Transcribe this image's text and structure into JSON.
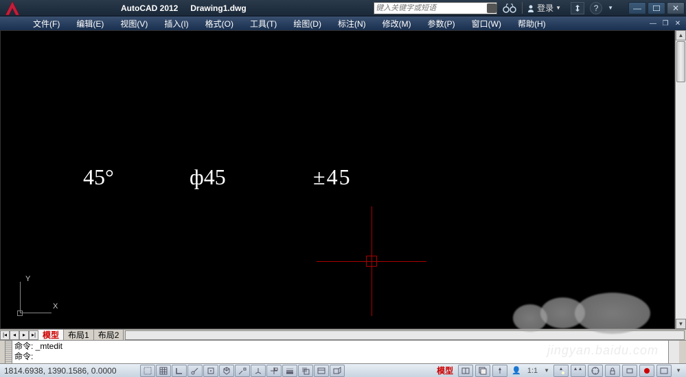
{
  "title": {
    "app": "AutoCAD 2012",
    "doc": "Drawing1.dwg"
  },
  "search": {
    "placeholder": "键入关键字或短语"
  },
  "login": {
    "label": "登录"
  },
  "menu": {
    "file": "文件(F)",
    "edit": "编辑(E)",
    "view": "视图(V)",
    "insert": "插入(I)",
    "format": "格式(O)",
    "tools": "工具(T)",
    "draw": "绘图(D)",
    "dim": "标注(N)",
    "modify": "修改(M)",
    "param": "参数(P)",
    "window": "窗口(W)",
    "help": "帮助(H)"
  },
  "canvas": {
    "text1": "45°",
    "text2": "ф45",
    "text3": "±45",
    "ucs_y": "Y",
    "ucs_x": "X"
  },
  "tabs": {
    "model": "模型",
    "layout1": "布局1",
    "layout2": "布局2"
  },
  "cmd": {
    "line1": "命令: _mtedit",
    "line2": "命令:"
  },
  "status": {
    "coords": "1814.6938, 1390.1586, 0.0000",
    "model": "模型",
    "scale": "1:1"
  },
  "watermark": "jingyan.baidu.com"
}
